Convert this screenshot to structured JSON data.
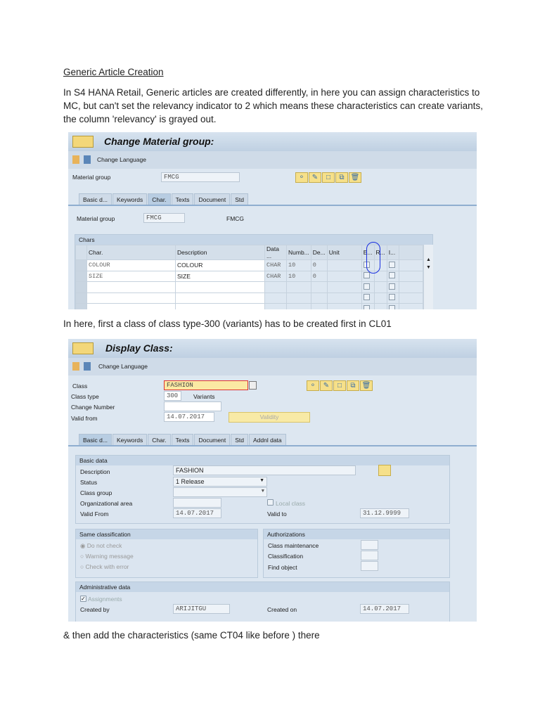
{
  "doc": {
    "title": "Generic Article Creation",
    "para1": "In S4 HANA Retail, Generic articles are created differently, in here you can assign characteristics to MC, but can't set the relevancy indicator to 2 which means these characteristics can create variants, the column 'relevancy' is grayed out.",
    "para2": "In here, first a class of class type-300 (variants) has to be created first in CL01",
    "para3": "& then add the characteristics (same CT04 like before ) there"
  },
  "s1": {
    "title": "Change Material group:",
    "change_language": "Change Language",
    "material_group_label": "Material group",
    "material_group_value": "FMCG",
    "tabs": [
      "Basic d...",
      "Keywords",
      "Char.",
      "Texts",
      "Document",
      "Std"
    ],
    "inner_label": "Material group",
    "inner_value": "FMCG",
    "inner_desc": "FMCG",
    "chars_title": "Chars",
    "columns": [
      "Char.",
      "Description",
      "Data ...",
      "Numb...",
      "De...",
      "Unit",
      "E...",
      "R...",
      "I..."
    ],
    "rows": [
      {
        "char": "COLOUR",
        "desc": "COLOUR",
        "type": "CHAR",
        "num": "10",
        "dec": "0"
      },
      {
        "char": "SIZE",
        "desc": "SIZE",
        "type": "CHAR",
        "num": "10",
        "dec": "0"
      }
    ]
  },
  "s2": {
    "title": "Display Class:",
    "change_language": "Change Language",
    "class_label": "Class",
    "class_value": "FASHION",
    "class_type_label": "Class type",
    "class_type_value": "300",
    "class_type_desc": "Variants",
    "change_number_label": "Change Number",
    "valid_from_label": "Valid from",
    "valid_from_value": "14.07.2017",
    "validity_button": "Validity",
    "tabs": [
      "Basic d...",
      "Keywords",
      "Char.",
      "Texts",
      "Document",
      "Std",
      "Addnl data"
    ],
    "basic": {
      "title": "Basic data",
      "description_label": "Description",
      "description_value": "FASHION",
      "status_label": "Status",
      "status_value": "1 Release",
      "class_group_label": "Class group",
      "org_area_label": "Organizational area",
      "local_class": "Local class",
      "valid_from_label": "Valid From",
      "valid_from_value": "14.07.2017",
      "valid_to_label": "Valid to",
      "valid_to_value": "31.12.9999"
    },
    "same": {
      "title": "Same classification",
      "options": [
        "Do not check",
        "Warning message",
        "Check with error"
      ]
    },
    "auth": {
      "title": "Authorizations",
      "items": [
        "Class maintenance",
        "Classification",
        "Find object"
      ]
    },
    "admin": {
      "title": "Administrative data",
      "assignments": "Assignments",
      "created_by_label": "Created by",
      "created_by_value": "ARIJITGU",
      "created_on_label": "Created on",
      "created_on_value": "14.07.2017"
    }
  }
}
